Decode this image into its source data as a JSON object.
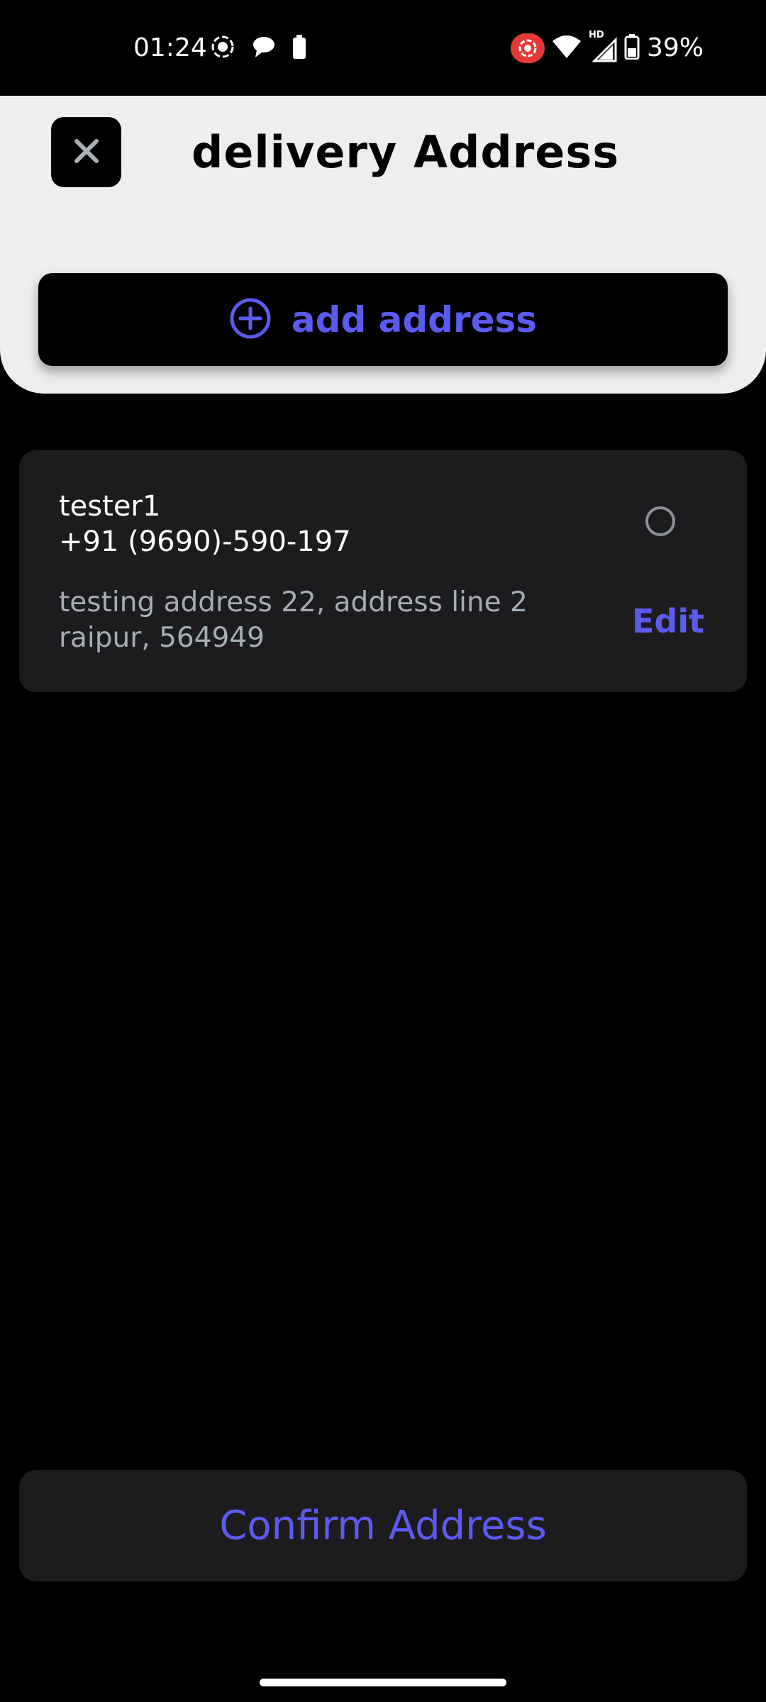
{
  "status_bar": {
    "time": "01:24",
    "battery_text": "39%",
    "icons": [
      "screen-record-icon",
      "chat-bubble-icon",
      "battery-small-icon",
      "recording-indicator-icon",
      "wifi-icon",
      "hd-signal-icon",
      "battery-icon"
    ],
    "hd_label": "HD"
  },
  "header": {
    "title": "delivery Address",
    "close_icon": "close-icon",
    "add_address_label": "add address",
    "add_icon": "plus-circle-icon"
  },
  "addresses": [
    {
      "name": "tester1",
      "phone": "+91 (9690)-590-197",
      "line1": "testing address 22, address line 2",
      "line2": "raipur, 564949",
      "edit_label": "Edit",
      "selected": false
    }
  ],
  "footer": {
    "confirm_label": "Confirm Address"
  },
  "colors": {
    "accent": "#5b5bf0",
    "background": "#000000",
    "header_bg": "#eeeeee",
    "card_bg": "#1c1c1e",
    "muted_text": "#a4adb5",
    "record_red": "#e53935"
  }
}
